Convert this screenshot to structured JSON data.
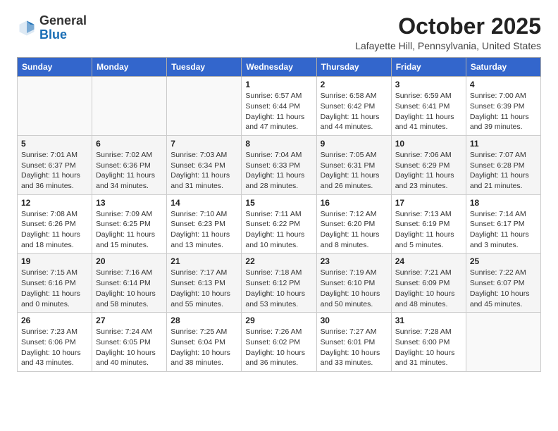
{
  "header": {
    "logo": {
      "general": "General",
      "blue": "Blue"
    },
    "month_title": "October 2025",
    "location": "Lafayette Hill, Pennsylvania, United States"
  },
  "weekdays": [
    "Sunday",
    "Monday",
    "Tuesday",
    "Wednesday",
    "Thursday",
    "Friday",
    "Saturday"
  ],
  "weeks": [
    [
      {
        "day": "",
        "info": ""
      },
      {
        "day": "",
        "info": ""
      },
      {
        "day": "",
        "info": ""
      },
      {
        "day": "1",
        "info": "Sunrise: 6:57 AM\nSunset: 6:44 PM\nDaylight: 11 hours\nand 47 minutes."
      },
      {
        "day": "2",
        "info": "Sunrise: 6:58 AM\nSunset: 6:42 PM\nDaylight: 11 hours\nand 44 minutes."
      },
      {
        "day": "3",
        "info": "Sunrise: 6:59 AM\nSunset: 6:41 PM\nDaylight: 11 hours\nand 41 minutes."
      },
      {
        "day": "4",
        "info": "Sunrise: 7:00 AM\nSunset: 6:39 PM\nDaylight: 11 hours\nand 39 minutes."
      }
    ],
    [
      {
        "day": "5",
        "info": "Sunrise: 7:01 AM\nSunset: 6:37 PM\nDaylight: 11 hours\nand 36 minutes."
      },
      {
        "day": "6",
        "info": "Sunrise: 7:02 AM\nSunset: 6:36 PM\nDaylight: 11 hours\nand 34 minutes."
      },
      {
        "day": "7",
        "info": "Sunrise: 7:03 AM\nSunset: 6:34 PM\nDaylight: 11 hours\nand 31 minutes."
      },
      {
        "day": "8",
        "info": "Sunrise: 7:04 AM\nSunset: 6:33 PM\nDaylight: 11 hours\nand 28 minutes."
      },
      {
        "day": "9",
        "info": "Sunrise: 7:05 AM\nSunset: 6:31 PM\nDaylight: 11 hours\nand 26 minutes."
      },
      {
        "day": "10",
        "info": "Sunrise: 7:06 AM\nSunset: 6:29 PM\nDaylight: 11 hours\nand 23 minutes."
      },
      {
        "day": "11",
        "info": "Sunrise: 7:07 AM\nSunset: 6:28 PM\nDaylight: 11 hours\nand 21 minutes."
      }
    ],
    [
      {
        "day": "12",
        "info": "Sunrise: 7:08 AM\nSunset: 6:26 PM\nDaylight: 11 hours\nand 18 minutes."
      },
      {
        "day": "13",
        "info": "Sunrise: 7:09 AM\nSunset: 6:25 PM\nDaylight: 11 hours\nand 15 minutes."
      },
      {
        "day": "14",
        "info": "Sunrise: 7:10 AM\nSunset: 6:23 PM\nDaylight: 11 hours\nand 13 minutes."
      },
      {
        "day": "15",
        "info": "Sunrise: 7:11 AM\nSunset: 6:22 PM\nDaylight: 11 hours\nand 10 minutes."
      },
      {
        "day": "16",
        "info": "Sunrise: 7:12 AM\nSunset: 6:20 PM\nDaylight: 11 hours\nand 8 minutes."
      },
      {
        "day": "17",
        "info": "Sunrise: 7:13 AM\nSunset: 6:19 PM\nDaylight: 11 hours\nand 5 minutes."
      },
      {
        "day": "18",
        "info": "Sunrise: 7:14 AM\nSunset: 6:17 PM\nDaylight: 11 hours\nand 3 minutes."
      }
    ],
    [
      {
        "day": "19",
        "info": "Sunrise: 7:15 AM\nSunset: 6:16 PM\nDaylight: 11 hours\nand 0 minutes."
      },
      {
        "day": "20",
        "info": "Sunrise: 7:16 AM\nSunset: 6:14 PM\nDaylight: 10 hours\nand 58 minutes."
      },
      {
        "day": "21",
        "info": "Sunrise: 7:17 AM\nSunset: 6:13 PM\nDaylight: 10 hours\nand 55 minutes."
      },
      {
        "day": "22",
        "info": "Sunrise: 7:18 AM\nSunset: 6:12 PM\nDaylight: 10 hours\nand 53 minutes."
      },
      {
        "day": "23",
        "info": "Sunrise: 7:19 AM\nSunset: 6:10 PM\nDaylight: 10 hours\nand 50 minutes."
      },
      {
        "day": "24",
        "info": "Sunrise: 7:21 AM\nSunset: 6:09 PM\nDaylight: 10 hours\nand 48 minutes."
      },
      {
        "day": "25",
        "info": "Sunrise: 7:22 AM\nSunset: 6:07 PM\nDaylight: 10 hours\nand 45 minutes."
      }
    ],
    [
      {
        "day": "26",
        "info": "Sunrise: 7:23 AM\nSunset: 6:06 PM\nDaylight: 10 hours\nand 43 minutes."
      },
      {
        "day": "27",
        "info": "Sunrise: 7:24 AM\nSunset: 6:05 PM\nDaylight: 10 hours\nand 40 minutes."
      },
      {
        "day": "28",
        "info": "Sunrise: 7:25 AM\nSunset: 6:04 PM\nDaylight: 10 hours\nand 38 minutes."
      },
      {
        "day": "29",
        "info": "Sunrise: 7:26 AM\nSunset: 6:02 PM\nDaylight: 10 hours\nand 36 minutes."
      },
      {
        "day": "30",
        "info": "Sunrise: 7:27 AM\nSunset: 6:01 PM\nDaylight: 10 hours\nand 33 minutes."
      },
      {
        "day": "31",
        "info": "Sunrise: 7:28 AM\nSunset: 6:00 PM\nDaylight: 10 hours\nand 31 minutes."
      },
      {
        "day": "",
        "info": ""
      }
    ]
  ]
}
